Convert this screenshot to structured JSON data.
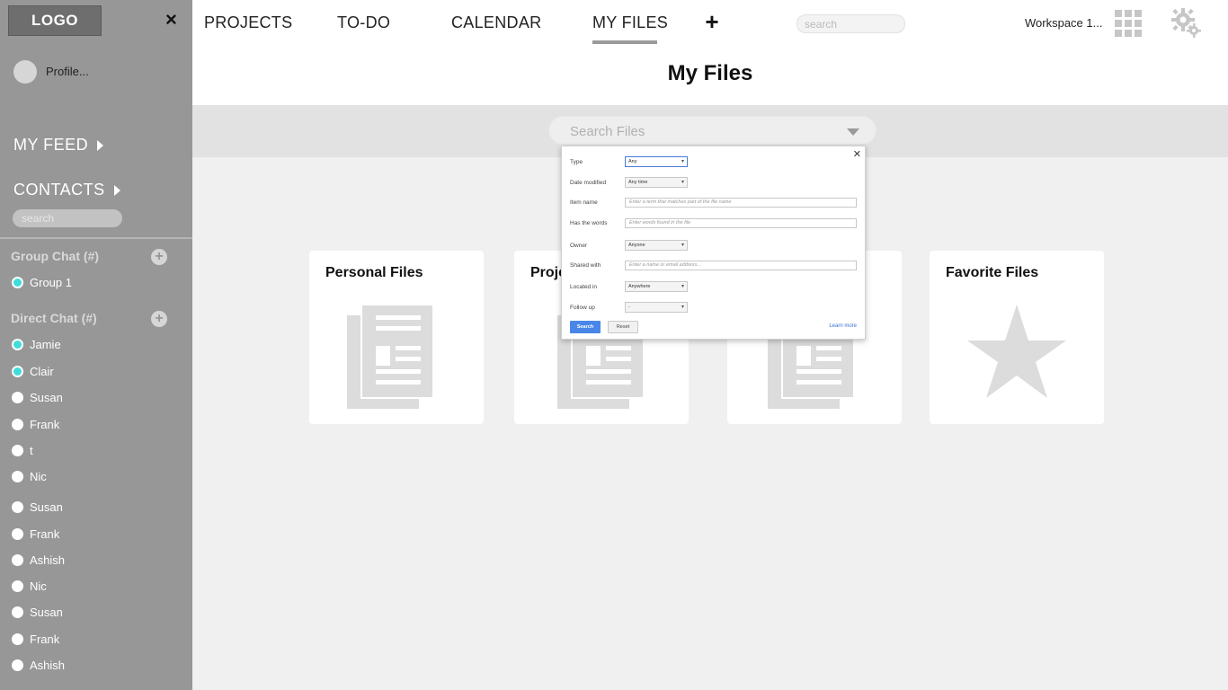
{
  "sidebar": {
    "logo": "LOGO",
    "close_icon": "×",
    "profile_label": "Profile...",
    "my_feed": "MY FEED",
    "contacts": "CONTACTS",
    "search_placeholder": "search",
    "group_chat_heading": "Group Chat (#)",
    "group_chats": [
      {
        "label": "Group 1",
        "online": true
      }
    ],
    "direct_chat_heading": "Direct Chat (#)",
    "direct_chats": [
      {
        "label": "Jamie",
        "online": true
      },
      {
        "label": "Clair",
        "online": true
      },
      {
        "label": "Susan",
        "online": false
      },
      {
        "label": "Frank",
        "online": false
      },
      {
        "label": "t",
        "online": false
      },
      {
        "label": "Nic",
        "online": false
      },
      {
        "label": "Susan",
        "online": false
      },
      {
        "label": "Frank",
        "online": false
      },
      {
        "label": "Ashish",
        "online": false
      },
      {
        "label": "Nic",
        "online": false
      },
      {
        "label": "Susan",
        "online": false
      },
      {
        "label": "Frank",
        "online": false
      },
      {
        "label": "Ashish",
        "online": false
      }
    ]
  },
  "topnav": {
    "tabs": [
      {
        "label": "PROJECTS"
      },
      {
        "label": "TO-DO"
      },
      {
        "label": "CALENDAR"
      },
      {
        "label": "MY FILES",
        "active": true
      }
    ],
    "search_placeholder": "search",
    "workspace": "Workspace 1..."
  },
  "page": {
    "title": "My Files",
    "files_search_label": "Search Files"
  },
  "cards": [
    {
      "title": "Personal Files",
      "icon": "document-icon"
    },
    {
      "title": "Proje",
      "icon": "document-icon"
    },
    {
      "title": "",
      "icon": "document-icon"
    },
    {
      "title": "Favorite Files",
      "icon": "star-icon"
    }
  ],
  "advanced_search": {
    "rows": [
      {
        "label": "Type",
        "kind": "select",
        "value": "Any"
      },
      {
        "label": "Date modified",
        "kind": "select",
        "value": "Any time"
      },
      {
        "label": "Item name",
        "kind": "input",
        "placeholder": "Enter a term that matches part of the file name"
      },
      {
        "label": "Has the words",
        "kind": "input",
        "placeholder": "Enter words found in the file"
      },
      {
        "label": "Owner",
        "kind": "select",
        "value": "Anyone"
      },
      {
        "label": "Shared with",
        "kind": "input",
        "placeholder": "Enter a name or email address..."
      },
      {
        "label": "Located in",
        "kind": "select",
        "value": "Anywhere"
      },
      {
        "label": "Follow up",
        "kind": "select",
        "value": "-"
      }
    ],
    "search_button": "Search",
    "reset_button": "Reset",
    "learn_more": "Learn more"
  },
  "colors": {
    "sidebar_bg": "#979797",
    "online_dot": "#3fdcdc",
    "primary_button": "#4a86e8"
  }
}
